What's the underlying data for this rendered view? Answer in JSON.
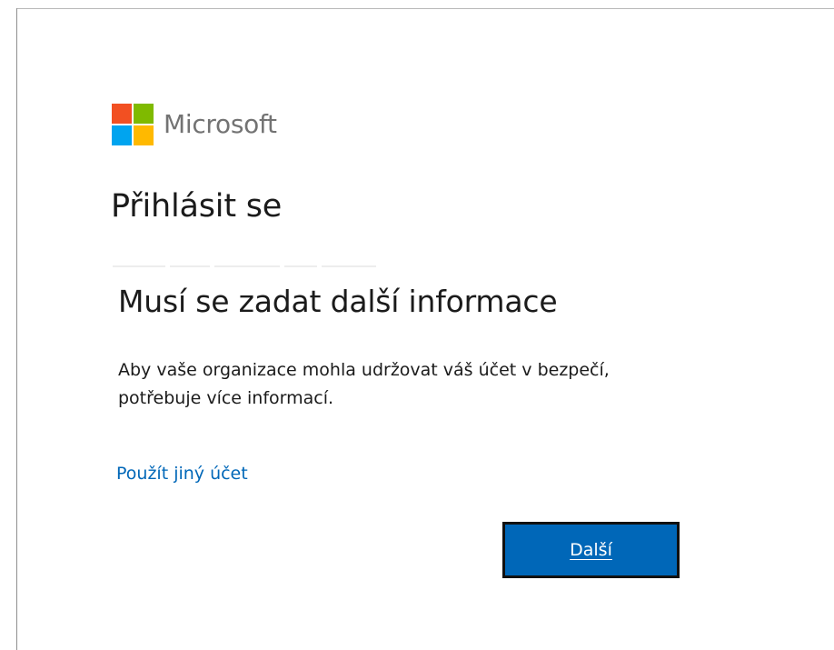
{
  "brand": {
    "name": "Microsoft",
    "logo_colors": [
      "#f25022",
      "#7fba00",
      "#00a4ef",
      "#ffb900"
    ],
    "text_color": "#737373"
  },
  "page": {
    "title": "Přihlásit se"
  },
  "prompt": {
    "heading": "Musí se zadat další informace",
    "body": "Aby vaše organizace mohla udržovat váš účet v bezpečí, potřebuje více informací."
  },
  "actions": {
    "other_account_link": "Použít jiný účet",
    "next_label": "Další"
  },
  "colors": {
    "accent": "#0067b8",
    "text": "#1b1b1b"
  }
}
